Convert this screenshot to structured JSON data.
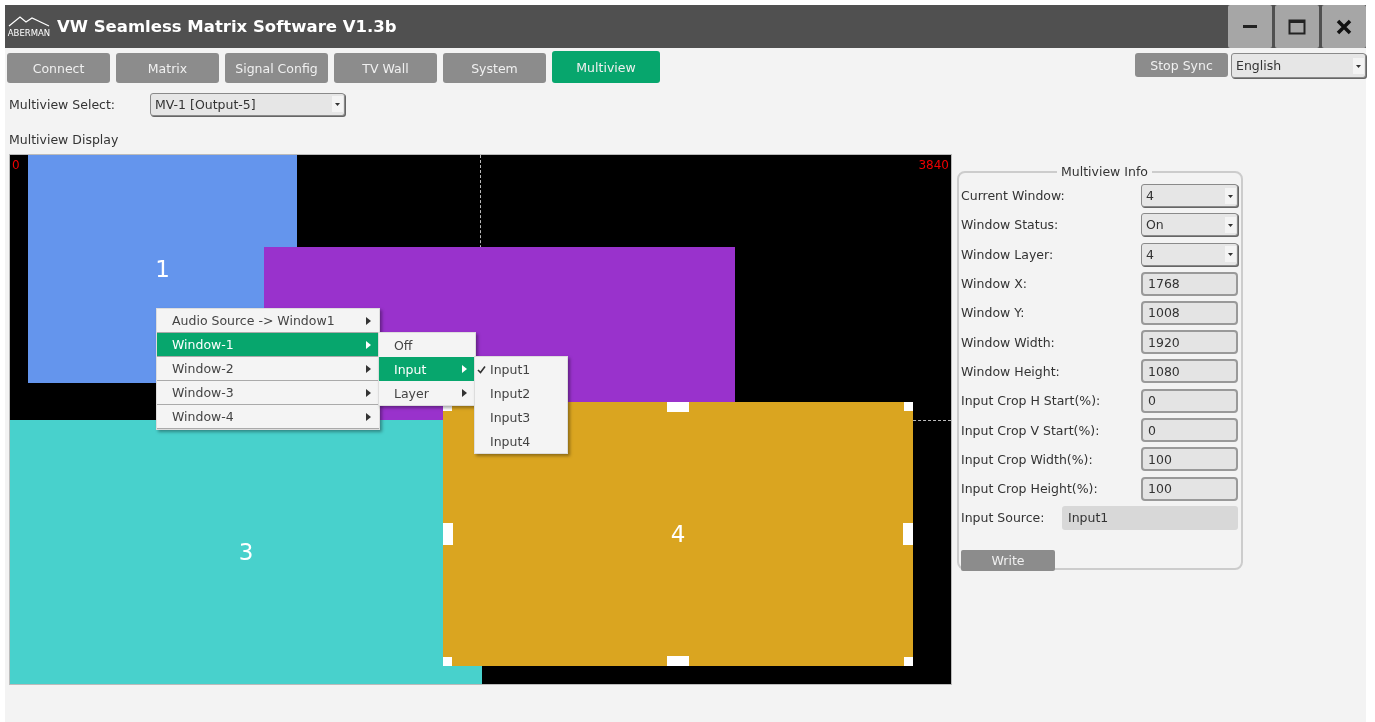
{
  "window": {
    "logo_text": "ABERMAN",
    "title": "VW Seamless Matrix Software V1.3b"
  },
  "tabs": [
    {
      "label": "Connect",
      "selected": false
    },
    {
      "label": "Matrix",
      "selected": false
    },
    {
      "label": "Signal Config",
      "selected": false
    },
    {
      "label": "TV Wall",
      "selected": false
    },
    {
      "label": "System",
      "selected": false
    },
    {
      "label": "Multiview",
      "selected": true
    }
  ],
  "stop_sync_button": "Stop Sync",
  "language_select": {
    "value": "English"
  },
  "multiview_select": {
    "label": "Multiview Select:",
    "value": "MV-1 [Output-5]"
  },
  "display": {
    "title": "Multiview Display",
    "origin_label": "0",
    "width_label": "3840",
    "windows": [
      {
        "label": "1",
        "color": "#6495ed",
        "selected": false
      },
      {
        "color": "#9932cc",
        "selected": false
      },
      {
        "label": "3",
        "color": "#48d1cc",
        "selected": false
      },
      {
        "label": "4",
        "color": "#daa520",
        "selected": true
      }
    ]
  },
  "context_menu": {
    "items": [
      {
        "label": "Audio Source -> Window1",
        "has_submenu": true,
        "selected": false
      },
      {
        "label": "Window-1",
        "has_submenu": true,
        "selected": true
      },
      {
        "label": "Window-2",
        "has_submenu": true,
        "selected": false
      },
      {
        "label": "Window-3",
        "has_submenu": true,
        "selected": false
      },
      {
        "label": "Window-4",
        "has_submenu": true,
        "selected": false
      }
    ],
    "submenu": {
      "items": [
        {
          "label": "Off",
          "has_submenu": false,
          "selected": false
        },
        {
          "label": "Input",
          "has_submenu": true,
          "selected": true
        },
        {
          "label": "Layer",
          "has_submenu": true,
          "selected": false
        }
      ],
      "submenu": {
        "items": [
          {
            "label": "Input1",
            "checked": true
          },
          {
            "label": "Input2",
            "checked": false
          },
          {
            "label": "Input3",
            "checked": false
          },
          {
            "label": "Input4",
            "checked": false
          }
        ]
      }
    }
  },
  "info_panel": {
    "title": "Multiview Info",
    "fields": [
      {
        "label": "Current Window:",
        "value": "4",
        "kind": "dropdown"
      },
      {
        "label": "Window Status:",
        "value": "On",
        "kind": "dropdown"
      },
      {
        "label": "Window Layer:",
        "value": "4",
        "kind": "dropdown"
      },
      {
        "label": "Window X:",
        "value": "1768",
        "kind": "text"
      },
      {
        "label": "Window Y:",
        "value": "1008",
        "kind": "text"
      },
      {
        "label": "Window Width:",
        "value": "1920",
        "kind": "text"
      },
      {
        "label": "Window Height:",
        "value": "1080",
        "kind": "text"
      },
      {
        "label": "Input Crop H Start(%):",
        "value": "0",
        "kind": "text"
      },
      {
        "label": "Input Crop V Start(%):",
        "value": "0",
        "kind": "text"
      },
      {
        "label": "Input Crop Width(%):",
        "value": "100",
        "kind": "text"
      },
      {
        "label": "Input Crop Height(%):",
        "value": "100",
        "kind": "text"
      },
      {
        "label": "Input Source:",
        "value": "Input1",
        "kind": "readonly"
      }
    ],
    "write_button": "Write"
  }
}
